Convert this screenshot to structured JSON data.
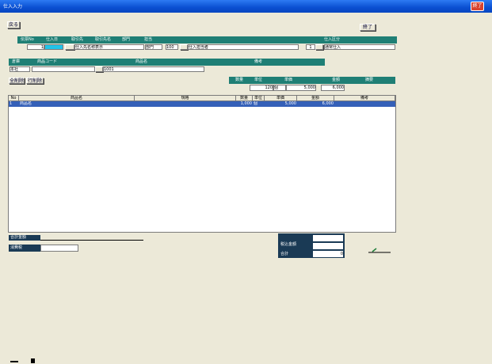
{
  "window": {
    "title": "仕入入力",
    "close_label": "終了"
  },
  "toolbar": {
    "back_label": "戻る",
    "exit_label": "終了"
  },
  "header_row1": {
    "labels": [
      "伝票No",
      "仕入日",
      "取引先",
      "取引先名",
      "部門",
      "担当",
      "仕入区分",
      "",
      "",
      "",
      ""
    ],
    "values": {
      "slip_no": "1",
      "date": "",
      "partner_name": "仕入先名称表示",
      "dept": "部門",
      "staff_code": "100",
      "staff_name": "仕入担当者",
      "kubun_code": "1",
      "kubun_name": "通常仕入"
    }
  },
  "header_row2": {
    "labels": [
      "倉庫",
      "商品コード",
      "商品名",
      "備考"
    ],
    "values": {
      "warehouse": "本社",
      "item_code": "1001"
    }
  },
  "small_buttons": [
    "全削除",
    "行削除"
  ],
  "summary": {
    "labels": [
      "数量",
      "単位",
      "単価",
      "金額",
      "摘要"
    ],
    "values": [
      "120",
      "個",
      "5,000",
      "6,000"
    ]
  },
  "grid": {
    "columns": [
      "No",
      "商品名",
      "規格",
      "数量",
      "単位",
      "単価",
      "金額",
      "備考"
    ],
    "rows": [
      {
        "no": "1",
        "name": "商品名",
        "spec": "",
        "qty": "1,000",
        "unit": "個",
        "price": "5,000",
        "amount": "6,000",
        "note": ""
      }
    ]
  },
  "footer": {
    "label1": "合計金額",
    "label2": "消費税",
    "value1": "",
    "value2": ""
  },
  "totals_panel": {
    "label_top": "税込金額",
    "label_bottom": "合計",
    "val_top": "",
    "val_mid": "",
    "val_bottom": "0"
  },
  "status": {
    "icon": "pen-icon"
  }
}
